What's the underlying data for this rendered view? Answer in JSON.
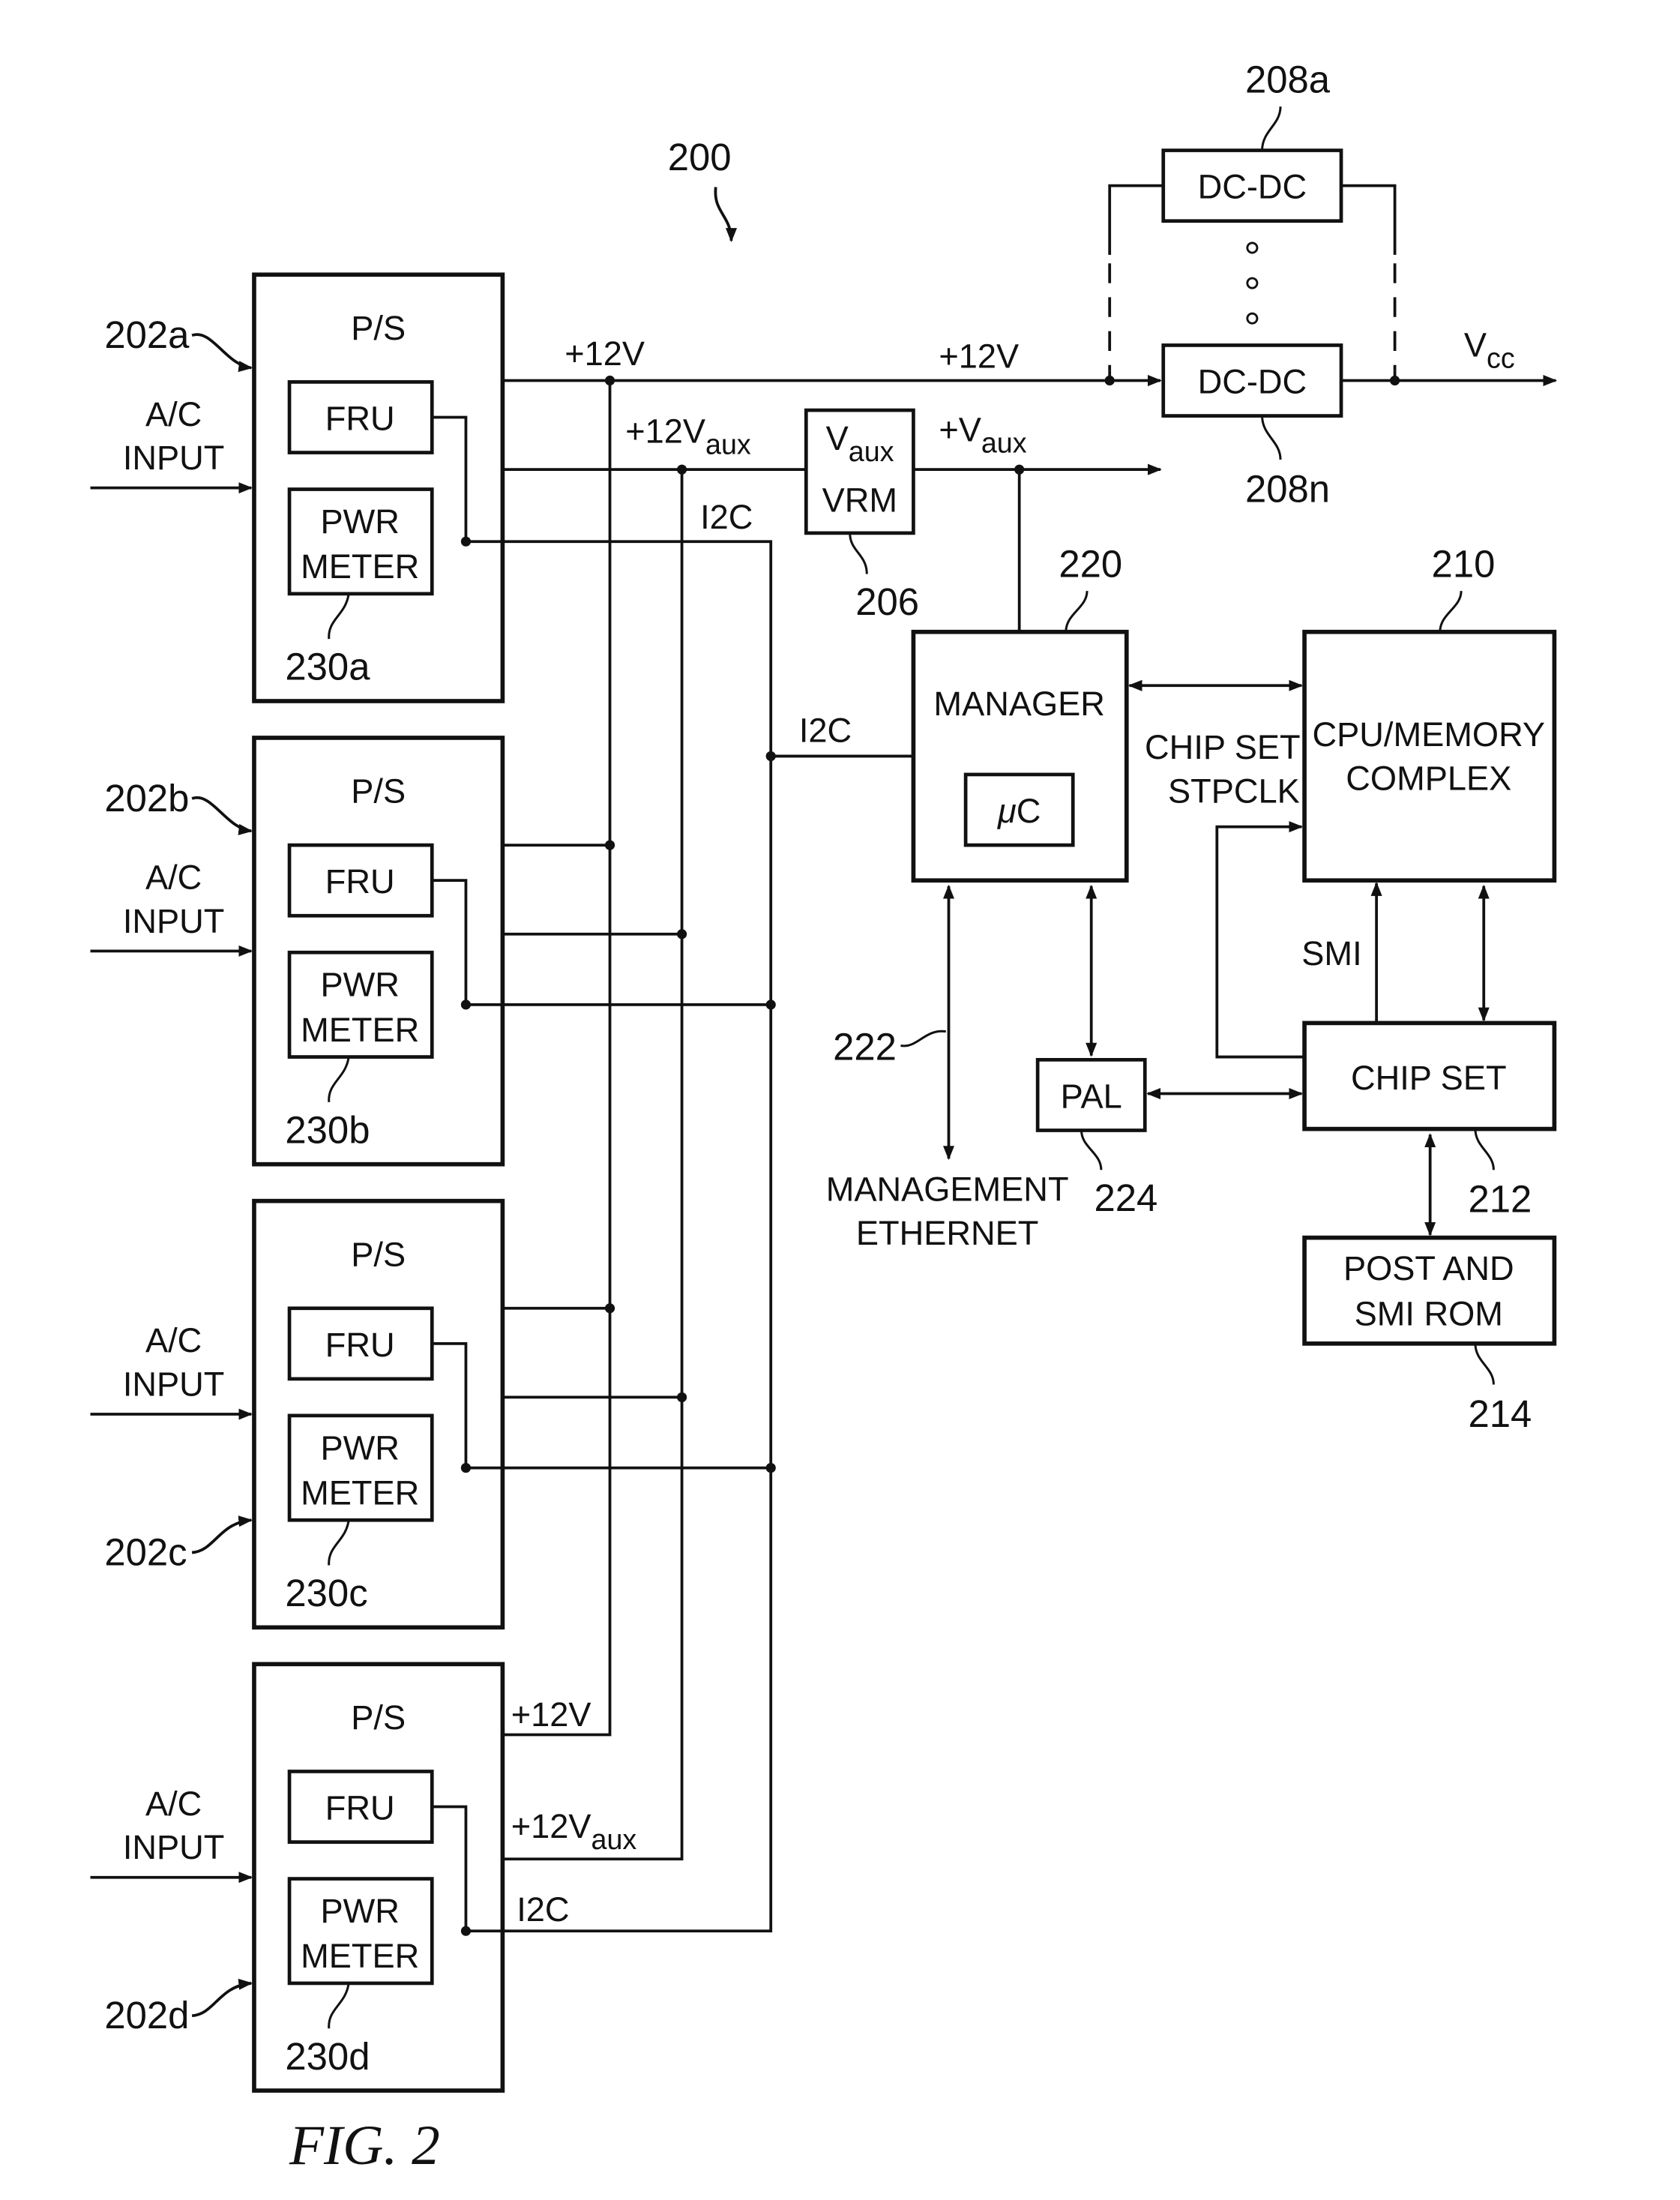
{
  "diagram": {
    "system_ref": "200",
    "figure_caption": "FIG. 2",
    "power_supplies": [
      {
        "ref": "202a",
        "title": "P/S",
        "input_label_1": "A/C",
        "input_label_2": "INPUT",
        "fru_label": "FRU",
        "meter_label_1": "PWR",
        "meter_label_2": "METER",
        "meter_ref": "230a"
      },
      {
        "ref": "202b",
        "title": "P/S",
        "input_label_1": "A/C",
        "input_label_2": "INPUT",
        "fru_label": "FRU",
        "meter_label_1": "PWR",
        "meter_label_2": "METER",
        "meter_ref": "230b"
      },
      {
        "ref": "202c",
        "title": "P/S",
        "input_label_1": "A/C",
        "input_label_2": "INPUT",
        "fru_label": "FRU",
        "meter_label_1": "PWR",
        "meter_label_2": "METER",
        "meter_ref": "230c"
      },
      {
        "ref": "202d",
        "title": "P/S",
        "input_label_1": "A/C",
        "input_label_2": "INPUT",
        "fru_label": "FRU",
        "meter_label_1": "PWR",
        "meter_label_2": "METER",
        "meter_ref": "230d"
      }
    ],
    "buses": {
      "v12": "+12V",
      "v12_mid": "+12V",
      "v12aux_main": "+12V",
      "aux_sub": "aux",
      "i2c": "I2C",
      "vaux_out_main": "+V",
      "vaux_out_sub": "aux",
      "vcc_main": "V",
      "vcc_sub": "cc"
    },
    "vrm": {
      "label_main": "V",
      "label_sub": "aux",
      "label_2": "VRM",
      "ref": "206"
    },
    "dcdc": [
      {
        "label": "DC-DC",
        "ref": "208a"
      },
      {
        "label": "DC-DC",
        "ref": "208n"
      }
    ],
    "manager": {
      "label": "MANAGER",
      "mc_mu": "μ",
      "mc_c": "C",
      "ref": "220",
      "i2c_label": "I2C"
    },
    "cpu": {
      "label_1": "CPU/MEMORY",
      "label_2": "COMPLEX",
      "ref": "210"
    },
    "chipset_stpclk": {
      "label_1": "CHIP SET",
      "label_2": "STPCLK"
    },
    "smi_label": "SMI",
    "chipset": {
      "label": "CHIP SET",
      "ref": "212"
    },
    "pal": {
      "label": "PAL",
      "ref": "224"
    },
    "ethernet": {
      "label_1": "MANAGEMENT",
      "label_2": "ETHERNET",
      "ref": "222"
    },
    "rom": {
      "label_1": "POST AND",
      "label_2": "SMI ROM",
      "ref": "214"
    }
  }
}
